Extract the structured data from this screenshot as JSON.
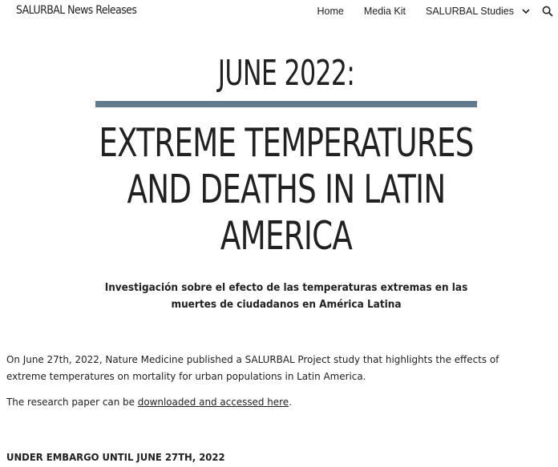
{
  "header": {
    "site_title": "SALURBAL News Releases",
    "nav": {
      "home": "Home",
      "media_kit": "Media Kit",
      "studies": "SALURBAL Studies"
    },
    "icons": {
      "studies_dropdown": "chevron-down-icon",
      "search": "search-icon"
    }
  },
  "main": {
    "date_heading": "JUNE 2022:",
    "title_lines": [
      "EXTREME TEMPERATURES",
      "AND DEATHS IN LATIN",
      "AMERICA"
    ],
    "subtitle_lines": [
      "Investigación sobre el efecto de las temperaturas extremas en las",
      "muertes de ciudadanos en América Latina"
    ],
    "paragraph1_lines": [
      "On June 27th, 2022, Nature Medicine published a SALURBAL Project study that highlights the effects of",
      "extreme temperatures on mortality for urban populations in Latin America."
    ],
    "paragraph2": {
      "before": "The research paper can be ",
      "link": "downloaded and accessed here",
      "after": "."
    },
    "embargo": "UNDER EMBARGO UNTIL JUNE 27TH, 2022"
  },
  "colors": {
    "divider": "#60798c",
    "text": "#212121",
    "background": "#ffffff"
  }
}
